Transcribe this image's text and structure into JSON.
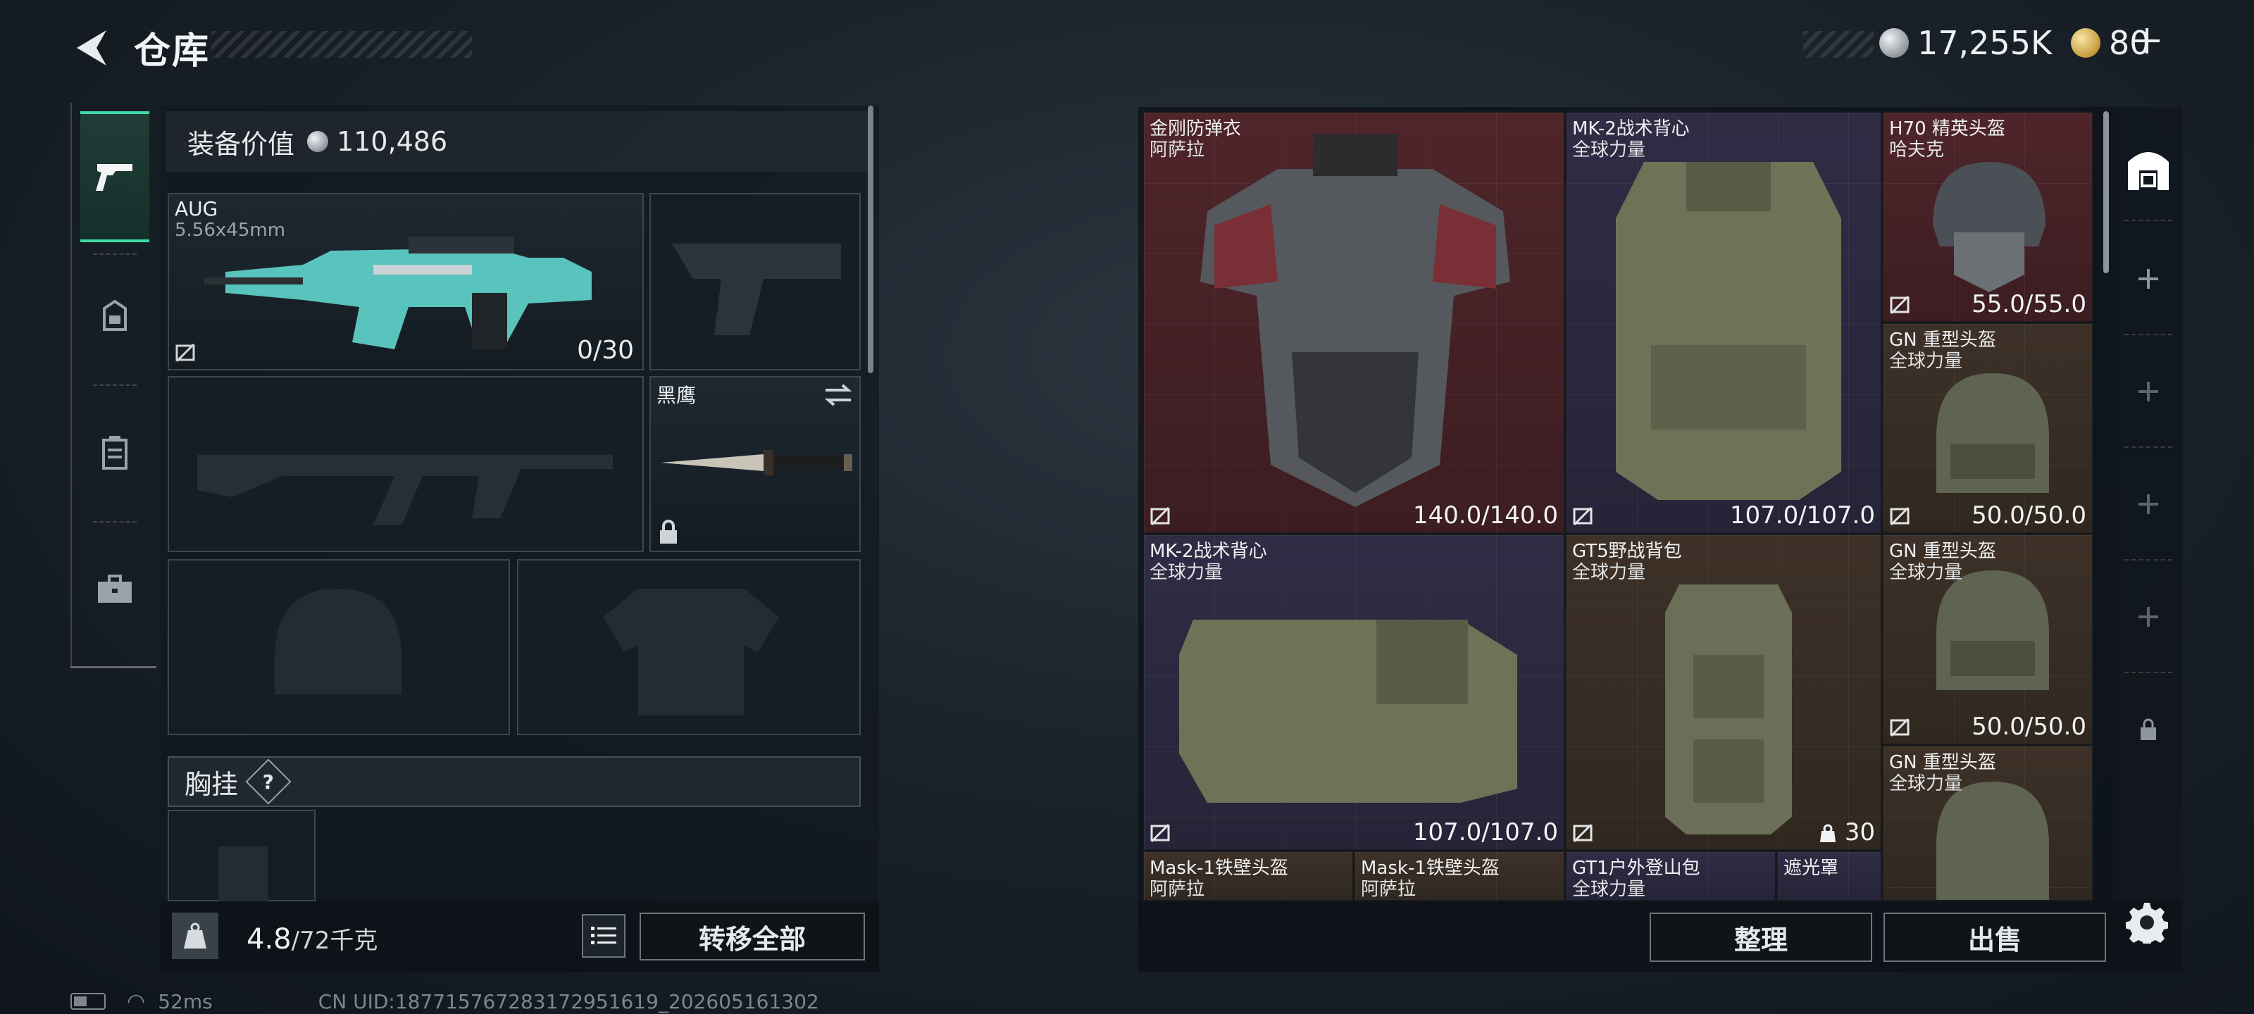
{
  "header": {
    "title": "仓库",
    "currency_silver": "17,255K",
    "currency_gold": "80"
  },
  "loadout": {
    "gear_value_label": "装备价值",
    "gear_value": "110,486",
    "primary_weapon": {
      "name": "AUG",
      "ammo_type": "5.56x45mm",
      "ammo": "0/30"
    },
    "melee": {
      "name": "黑鹰"
    },
    "chest_rig_label": "胸挂",
    "help_symbol": "?",
    "weight_current": "4.8",
    "weight_max": "/72千克",
    "transfer_all_label": "转移全部"
  },
  "warehouse": {
    "items": [
      {
        "name": "金刚防弹衣",
        "origin": "阿萨拉",
        "durability": "140.0/140.0",
        "rarity": "red"
      },
      {
        "name": "MK-2战术背心",
        "origin": "全球力量",
        "durability": "107.0/107.0",
        "rarity": "purple"
      },
      {
        "name": "H70 精英头盔",
        "origin": "哈夫克",
        "durability": "55.0/55.0",
        "rarity": "red"
      },
      {
        "name": "GN 重型头盔",
        "origin": "全球力量",
        "durability": "50.0/50.0",
        "rarity": "brown"
      },
      {
        "name": "MK-2战术背心",
        "origin": "全球力量",
        "durability": "107.0/107.0",
        "rarity": "purple"
      },
      {
        "name": "GT5野战背包",
        "origin": "全球力量",
        "capacity": "30",
        "rarity": "brown"
      },
      {
        "name": "GN 重型头盔",
        "origin": "全球力量",
        "durability": "50.0/50.0",
        "rarity": "brown"
      },
      {
        "name": "GN 重型头盔",
        "origin": "全球力量",
        "rarity": "brown"
      },
      {
        "name": "Mask-1铁壁头盔",
        "origin": "阿萨拉",
        "rarity": "brown"
      },
      {
        "name": "Mask-1铁壁头盔",
        "origin": "阿萨拉",
        "rarity": "brown"
      },
      {
        "name": "GT1户外登山包",
        "origin": "全球力量",
        "rarity": "purple"
      },
      {
        "name": "遮光罩",
        "origin": "",
        "rarity": "purple"
      }
    ],
    "sort_label": "整理",
    "sell_label": "出售"
  },
  "status": {
    "ping": "52ms",
    "uid": "CN UID:18771576728317295161​9_202605161302"
  },
  "colors": {
    "accent": "#3fd9a5",
    "rarity_red": "#4f252a",
    "rarity_purple": "#2f2d45",
    "rarity_brown": "#3d3128"
  },
  "icons": [
    "back-arrow-icon",
    "pistol-icon",
    "helmet-icon",
    "vest-icon",
    "briefcase-icon",
    "kg-icon",
    "list-icon",
    "shelf-icon",
    "lock-icon",
    "settings-icon",
    "swap-icon",
    "no-insure-icon",
    "battery-icon",
    "wifi-icon"
  ]
}
